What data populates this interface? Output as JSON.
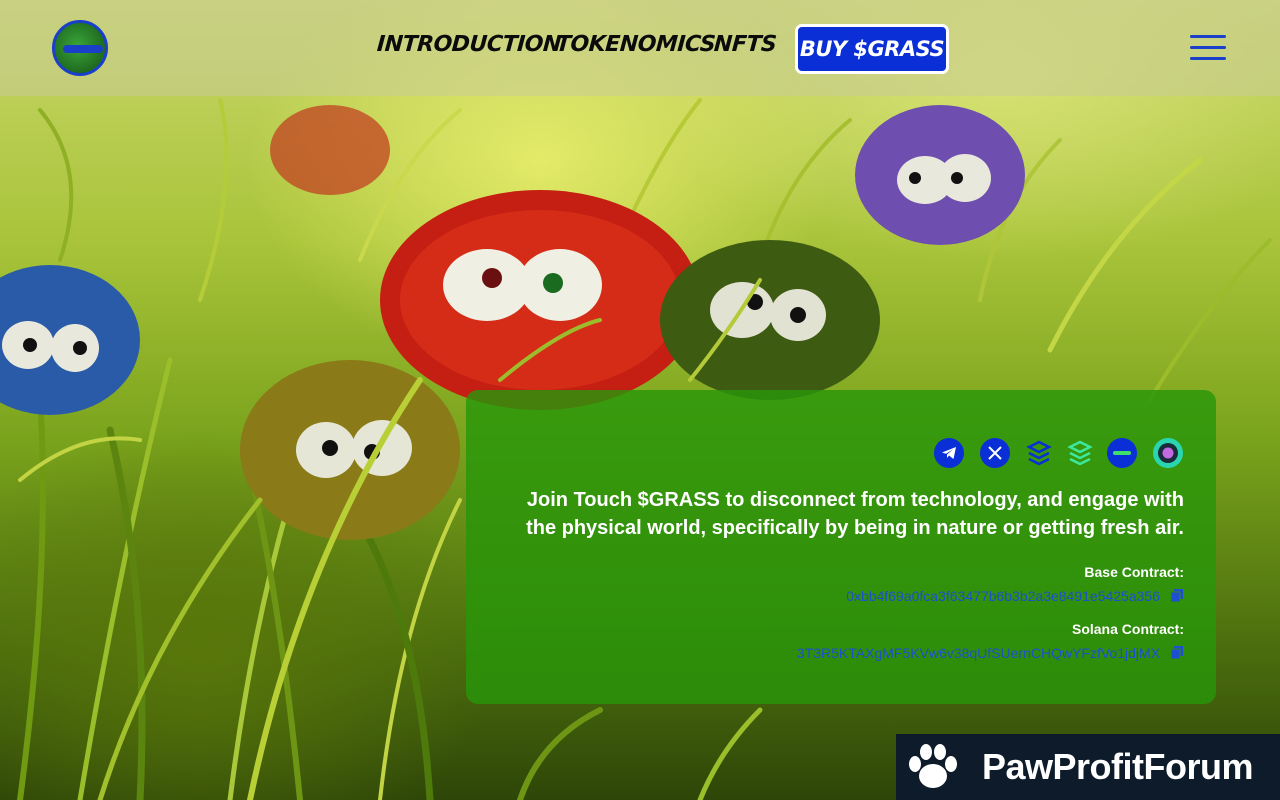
{
  "nav": {
    "items": [
      {
        "label": "INTRODUCTION"
      },
      {
        "label": "TOKENOMICS"
      },
      {
        "label": "NFTS"
      }
    ],
    "buy_label": "BUY $GRASS"
  },
  "colors": {
    "accent_blue": "#0a2fd6",
    "card_green": "#2896 0a",
    "address_blue": "#1e4fd0"
  },
  "social_icons": [
    "telegram-icon",
    "x-icon",
    "dextools-icon",
    "dexscreener-icon",
    "coinmarketcap-icon",
    "geckoterminal-icon"
  ],
  "card": {
    "tagline": "Join Touch $GRASS to disconnect from technology, and engage with the physical world, specifically by being in nature or getting fresh air.",
    "base_label": "Base Contract:",
    "base_address": "0xbb4f69a0fca3f63477b6b3b2a3e8491e5425a356",
    "solana_label": "Solana Contract:",
    "solana_address": "3T3R5KTAXgMF5KVw6v38qUfSUernCHQwYFzfVo1jdjMX"
  },
  "watermark": {
    "text": "PawProfitForum"
  }
}
